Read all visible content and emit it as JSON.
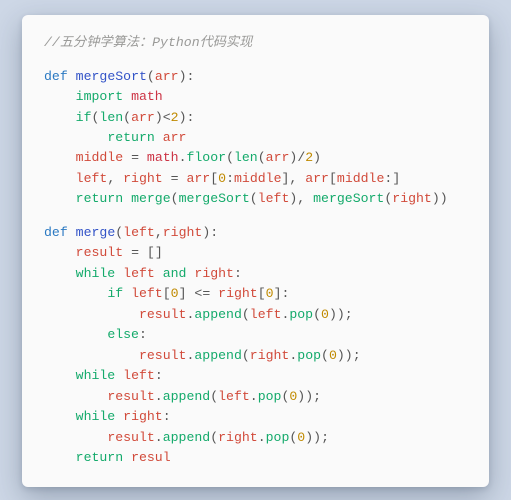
{
  "comment": "//五分钟学算法：Python代码实现",
  "kw_def": "def",
  "kw_import": "import",
  "kw_if": "if",
  "kw_else": "else",
  "kw_while": "while",
  "kw_return": "return",
  "kw_and": "and",
  "fn_mergeSort": "mergeSort",
  "fn_merge": "merge",
  "id_arr": "arr",
  "id_math": "math",
  "id_len": "len",
  "id_floor": "floor",
  "id_middle": "middle",
  "id_left": "left",
  "id_right": "right",
  "id_result": "result",
  "id_append": "append",
  "id_pop": "pop",
  "id_resul": "resul",
  "n0": "0",
  "n2": "2",
  "p_open": "(",
  "p_close": ")",
  "p_colon": ":",
  "p_comma_sp": ", ",
  "p_comma": ",",
  "p_lt": "<",
  "p_lte": "<=",
  "p_eq": "=",
  "p_dot": ".",
  "p_slash": "/",
  "p_lbr": "[",
  "p_rbr": "]",
  "p_brs": "[]",
  "p_semi": ";"
}
